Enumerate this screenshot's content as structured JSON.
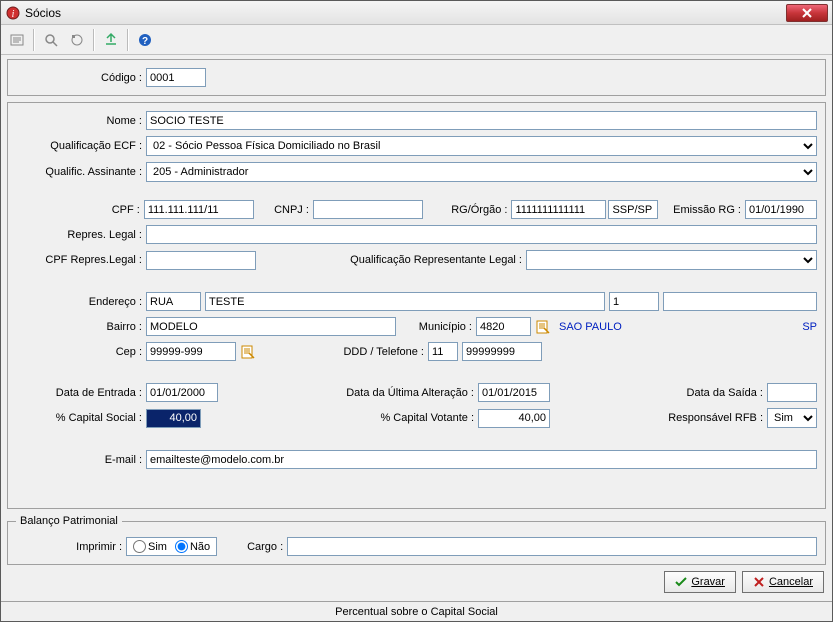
{
  "window": {
    "title": "Sócios"
  },
  "codigo": {
    "label": "Código :",
    "value": "0001"
  },
  "nome": {
    "label": "Nome :",
    "value": "SOCIO TESTE"
  },
  "qualif_ecf": {
    "label": "Qualificação ECF :",
    "value": "02 - Sócio Pessoa Física Domiciliado no Brasil"
  },
  "qualif_assinante": {
    "label": "Qualific. Assinante :",
    "value": "205 - Administrador"
  },
  "cpf": {
    "label": "CPF :",
    "value": "111.111.111/11"
  },
  "cnpj": {
    "label": "CNPJ :",
    "value": ""
  },
  "rg": {
    "label": "RG/Órgão :",
    "value": "1111111111111",
    "orgao": "SSP/SP"
  },
  "emissao_rg": {
    "label": "Emissão RG :",
    "value": "01/01/1990"
  },
  "repres_legal": {
    "label": "Repres. Legal :",
    "value": ""
  },
  "cpf_repres": {
    "label": "CPF Repres.Legal :",
    "value": ""
  },
  "qualif_repres": {
    "label": "Qualificação Representante Legal :",
    "value": ""
  },
  "endereco": {
    "label": "Endereço :",
    "tipo": "RUA",
    "logradouro": "TESTE",
    "numero": "1",
    "complemento": ""
  },
  "bairro": {
    "label": "Bairro :",
    "value": "MODELO"
  },
  "municipio": {
    "label": "Município :",
    "codigo": "4820",
    "nome": "SAO PAULO",
    "uf": "SP"
  },
  "cep": {
    "label": "Cep :",
    "value": "99999-999"
  },
  "ddd_tel": {
    "label": "DDD / Telefone :",
    "ddd": "11",
    "tel": "99999999"
  },
  "data_entrada": {
    "label": "Data de Entrada :",
    "value": "01/01/2000"
  },
  "data_ultima_alt": {
    "label": "Data da Última Alteração :",
    "value": "01/01/2015"
  },
  "data_saida": {
    "label": "Data da Saída :",
    "value": ""
  },
  "pct_capital_social": {
    "label": "% Capital Social :",
    "value": "40,00"
  },
  "pct_capital_votante": {
    "label": "% Capital Votante :",
    "value": "40,00"
  },
  "responsavel_rfb": {
    "label": "Responsável RFB :",
    "value": "Sim"
  },
  "email": {
    "label": "E-mail :",
    "value": "emailteste@modelo.com.br"
  },
  "balanco": {
    "legend": "Balanço Patrimonial",
    "imprimir": {
      "label": "Imprimir :",
      "sim": "Sim",
      "nao": "Não",
      "value": "Não"
    },
    "cargo": {
      "label": "Cargo :",
      "value": ""
    }
  },
  "buttons": {
    "gravar": "Gravar",
    "cancelar": "Cancelar"
  },
  "statusbar": "Percentual sobre o Capital  Social"
}
